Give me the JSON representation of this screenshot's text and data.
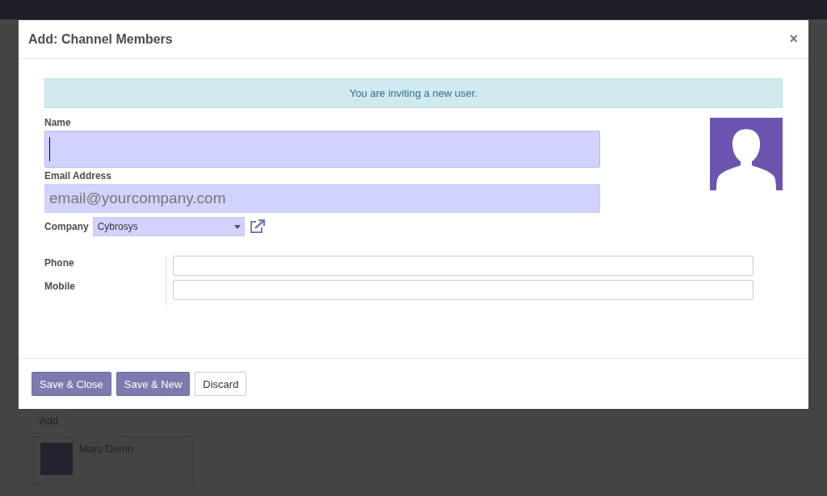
{
  "dialog": {
    "title": "Add: Channel Members",
    "close": "×",
    "alert": "You are inviting a new user.",
    "fields": [
      {
        "label": "Name",
        "focused": true
      },
      {
        "label": "Email Address",
        "placeholder": "email@yourcompany.com",
        "focused": false
      }
    ],
    "company": {
      "label": "Company",
      "value": "Cybrosys"
    },
    "contacts": [
      {
        "label": "Phone"
      },
      {
        "label": "Mobile"
      }
    ],
    "buttons": [
      {
        "label": "Save & Close",
        "kind": "primary"
      },
      {
        "label": "Save & New",
        "kind": "primary"
      },
      {
        "label": "Discard",
        "kind": "secondary"
      }
    ]
  },
  "background": {
    "add_button": "Add",
    "member": {
      "name": "Marc Demo"
    }
  }
}
